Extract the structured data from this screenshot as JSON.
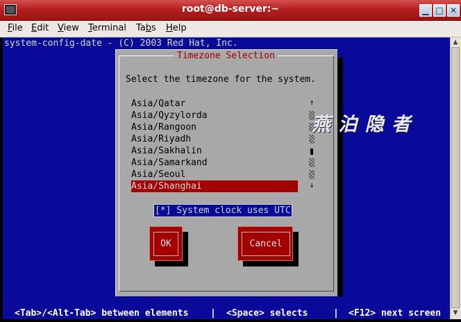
{
  "window": {
    "title": "root@db-server:~",
    "buttons": {
      "minimize": "▁",
      "maximize": "□",
      "close": "✕"
    }
  },
  "menu": [
    {
      "label": "File",
      "mnemonic": "F",
      "rest": "ile"
    },
    {
      "label": "Edit",
      "mnemonic": "E",
      "rest": "dit"
    },
    {
      "label": "View",
      "mnemonic": "V",
      "rest": "iew"
    },
    {
      "label": "Terminal",
      "mnemonic": "T",
      "rest": "erminal"
    },
    {
      "label": "Tabs",
      "pre": "Ta",
      "mnemonic": "b",
      "rest": "s"
    },
    {
      "label": "Help",
      "mnemonic": "H",
      "rest": "elp"
    }
  ],
  "terminal": {
    "header": "system-config-date - (C) 2003 Red Hat, Inc.",
    "footer": {
      "tab": "<Tab>/<Alt-Tab> between elements",
      "sep1": "|",
      "space": "<Space> selects",
      "sep2": "|",
      "f12": "<F12> next screen"
    }
  },
  "dialog": {
    "title": "Timezone Selection",
    "instruction": "Select the timezone for the system.",
    "timezones": [
      "Asia/Qatar",
      "Asia/Qyzylorda",
      "Asia/Rangoon",
      "Asia/Riyadh",
      "Asia/Sakhalin",
      "Asia/Samarkand",
      "Asia/Seoul",
      "Asia/Shanghai"
    ],
    "selected_timezone": "Asia/Shanghai",
    "scroll_marks": [
      "↑",
      "▒",
      "▒",
      "▒",
      "▪",
      "▒",
      "▒",
      "↓"
    ],
    "utc_checkbox": "[*] System clock uses UTC",
    "ok_label": "OK",
    "cancel_label": "Cancel"
  },
  "watermark": "燕 泊 隐 者",
  "colors": {
    "terminal_bg": "#0a0a9a",
    "dialog_bg": "#a8a8a8",
    "selection": "#a30000",
    "title_text": "#a00000"
  }
}
